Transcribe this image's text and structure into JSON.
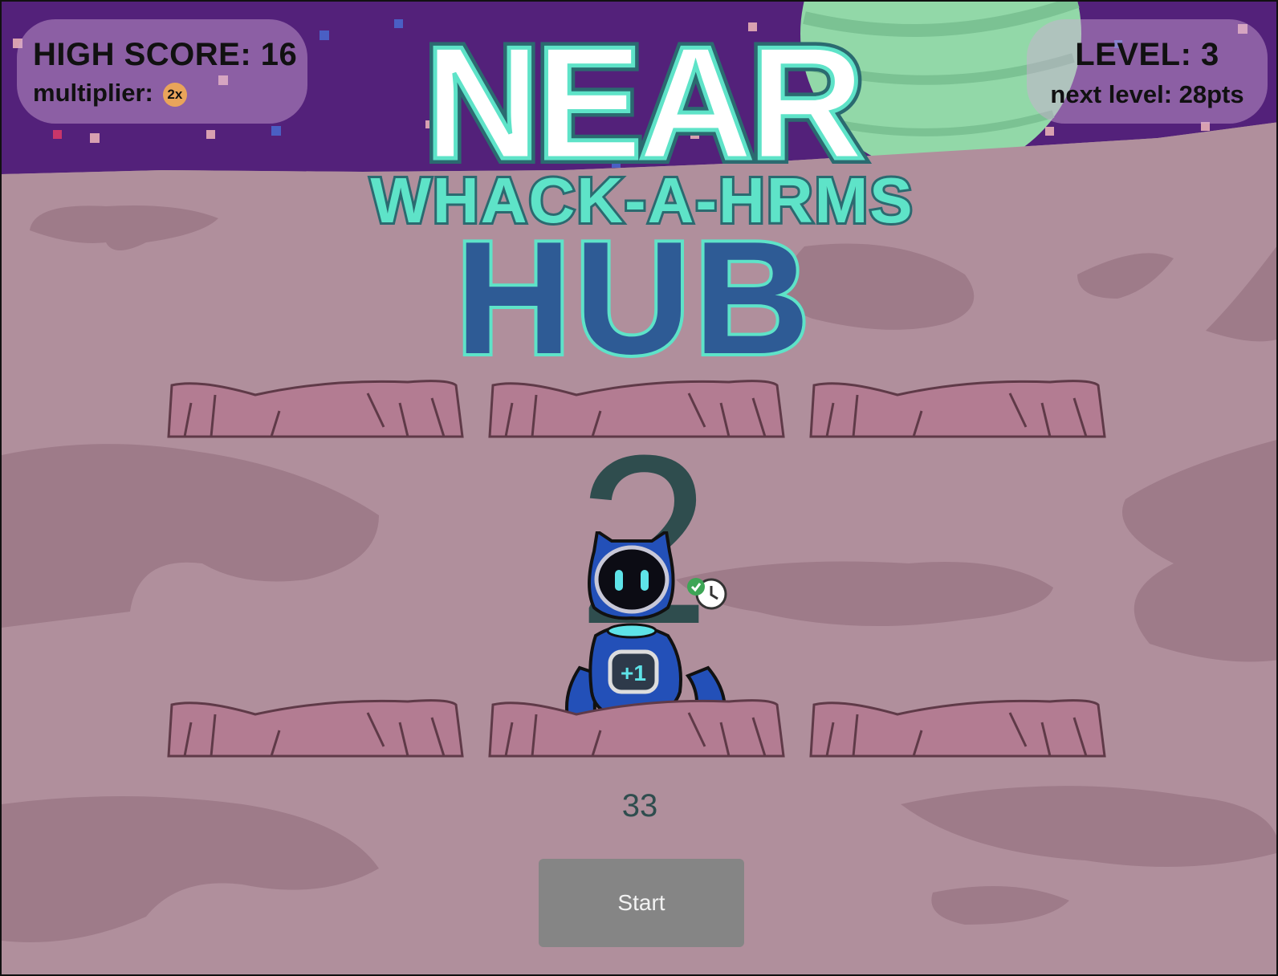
{
  "hud_left": {
    "high_score": "HIGH SCORE: 16",
    "multiplier_label": "multiplier:",
    "multiplier_badge": "2x"
  },
  "hud_right": {
    "level": "LEVEL: 3",
    "next_level": "next level: 28pts"
  },
  "logo": {
    "line1": "NEAR",
    "line2": "WHACK-A-HRMS",
    "line3": "HUB"
  },
  "game": {
    "countdown": "2",
    "timer": "33",
    "robot_badge": "+1",
    "start_label": "Start"
  },
  "colors": {
    "sky": "#53217a",
    "ground": "#b08f9c",
    "ground_dark": "#9e7b89",
    "mound": "#b37c92",
    "logo_teal": "#5ee3c8",
    "logo_blue": "#2e5b95",
    "robot_blue": "#2350b8"
  },
  "icons": [
    "clock-icon",
    "check-icon",
    "planet-icon",
    "robot-icon"
  ]
}
